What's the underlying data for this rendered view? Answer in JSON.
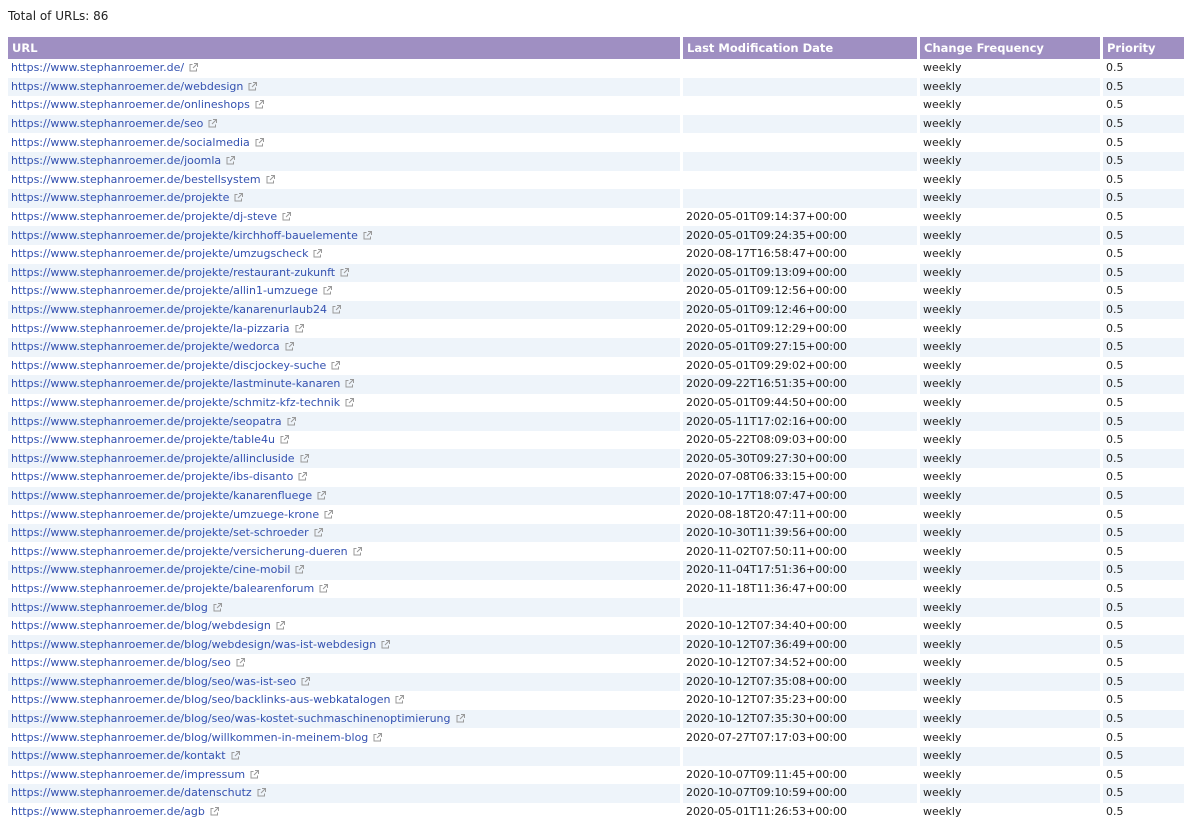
{
  "summary": {
    "total_label": "Total of URLs: 86"
  },
  "table": {
    "headers": {
      "url": "URL",
      "lastmod": "Last Modification Date",
      "changefreq": "Change Frequency",
      "priority": "Priority"
    },
    "rows": [
      {
        "url": "https://www.stephanroemer.de/",
        "lastmod": "",
        "changefreq": "weekly",
        "priority": "0.5"
      },
      {
        "url": "https://www.stephanroemer.de/webdesign",
        "lastmod": "",
        "changefreq": "weekly",
        "priority": "0.5"
      },
      {
        "url": "https://www.stephanroemer.de/onlineshops",
        "lastmod": "",
        "changefreq": "weekly",
        "priority": "0.5"
      },
      {
        "url": "https://www.stephanroemer.de/seo",
        "lastmod": "",
        "changefreq": "weekly",
        "priority": "0.5"
      },
      {
        "url": "https://www.stephanroemer.de/socialmedia",
        "lastmod": "",
        "changefreq": "weekly",
        "priority": "0.5"
      },
      {
        "url": "https://www.stephanroemer.de/joomla",
        "lastmod": "",
        "changefreq": "weekly",
        "priority": "0.5"
      },
      {
        "url": "https://www.stephanroemer.de/bestellsystem",
        "lastmod": "",
        "changefreq": "weekly",
        "priority": "0.5"
      },
      {
        "url": "https://www.stephanroemer.de/projekte",
        "lastmod": "",
        "changefreq": "weekly",
        "priority": "0.5"
      },
      {
        "url": "https://www.stephanroemer.de/projekte/dj-steve",
        "lastmod": "2020-05-01T09:14:37+00:00",
        "changefreq": "weekly",
        "priority": "0.5"
      },
      {
        "url": "https://www.stephanroemer.de/projekte/kirchhoff-bauelemente",
        "lastmod": "2020-05-01T09:24:35+00:00",
        "changefreq": "weekly",
        "priority": "0.5"
      },
      {
        "url": "https://www.stephanroemer.de/projekte/umzugscheck",
        "lastmod": "2020-08-17T16:58:47+00:00",
        "changefreq": "weekly",
        "priority": "0.5"
      },
      {
        "url": "https://www.stephanroemer.de/projekte/restaurant-zukunft",
        "lastmod": "2020-05-01T09:13:09+00:00",
        "changefreq": "weekly",
        "priority": "0.5"
      },
      {
        "url": "https://www.stephanroemer.de/projekte/allin1-umzuege",
        "lastmod": "2020-05-01T09:12:56+00:00",
        "changefreq": "weekly",
        "priority": "0.5"
      },
      {
        "url": "https://www.stephanroemer.de/projekte/kanarenurlaub24",
        "lastmod": "2020-05-01T09:12:46+00:00",
        "changefreq": "weekly",
        "priority": "0.5"
      },
      {
        "url": "https://www.stephanroemer.de/projekte/la-pizzaria",
        "lastmod": "2020-05-01T09:12:29+00:00",
        "changefreq": "weekly",
        "priority": "0.5"
      },
      {
        "url": "https://www.stephanroemer.de/projekte/wedorca",
        "lastmod": "2020-05-01T09:27:15+00:00",
        "changefreq": "weekly",
        "priority": "0.5"
      },
      {
        "url": "https://www.stephanroemer.de/projekte/discjockey-suche",
        "lastmod": "2020-05-01T09:29:02+00:00",
        "changefreq": "weekly",
        "priority": "0.5"
      },
      {
        "url": "https://www.stephanroemer.de/projekte/lastminute-kanaren",
        "lastmod": "2020-09-22T16:51:35+00:00",
        "changefreq": "weekly",
        "priority": "0.5"
      },
      {
        "url": "https://www.stephanroemer.de/projekte/schmitz-kfz-technik",
        "lastmod": "2020-05-01T09:44:50+00:00",
        "changefreq": "weekly",
        "priority": "0.5"
      },
      {
        "url": "https://www.stephanroemer.de/projekte/seopatra",
        "lastmod": "2020-05-11T17:02:16+00:00",
        "changefreq": "weekly",
        "priority": "0.5"
      },
      {
        "url": "https://www.stephanroemer.de/projekte/table4u",
        "lastmod": "2020-05-22T08:09:03+00:00",
        "changefreq": "weekly",
        "priority": "0.5"
      },
      {
        "url": "https://www.stephanroemer.de/projekte/allincluside",
        "lastmod": "2020-05-30T09:27:30+00:00",
        "changefreq": "weekly",
        "priority": "0.5"
      },
      {
        "url": "https://www.stephanroemer.de/projekte/ibs-disanto",
        "lastmod": "2020-07-08T06:33:15+00:00",
        "changefreq": "weekly",
        "priority": "0.5"
      },
      {
        "url": "https://www.stephanroemer.de/projekte/kanarenfluege",
        "lastmod": "2020-10-17T18:07:47+00:00",
        "changefreq": "weekly",
        "priority": "0.5"
      },
      {
        "url": "https://www.stephanroemer.de/projekte/umzuege-krone",
        "lastmod": "2020-08-18T20:47:11+00:00",
        "changefreq": "weekly",
        "priority": "0.5"
      },
      {
        "url": "https://www.stephanroemer.de/projekte/set-schroeder",
        "lastmod": "2020-10-30T11:39:56+00:00",
        "changefreq": "weekly",
        "priority": "0.5"
      },
      {
        "url": "https://www.stephanroemer.de/projekte/versicherung-dueren",
        "lastmod": "2020-11-02T07:50:11+00:00",
        "changefreq": "weekly",
        "priority": "0.5"
      },
      {
        "url": "https://www.stephanroemer.de/projekte/cine-mobil",
        "lastmod": "2020-11-04T17:51:36+00:00",
        "changefreq": "weekly",
        "priority": "0.5"
      },
      {
        "url": "https://www.stephanroemer.de/projekte/balearenforum",
        "lastmod": "2020-11-18T11:36:47+00:00",
        "changefreq": "weekly",
        "priority": "0.5"
      },
      {
        "url": "https://www.stephanroemer.de/blog",
        "lastmod": "",
        "changefreq": "weekly",
        "priority": "0.5"
      },
      {
        "url": "https://www.stephanroemer.de/blog/webdesign",
        "lastmod": "2020-10-12T07:34:40+00:00",
        "changefreq": "weekly",
        "priority": "0.5"
      },
      {
        "url": "https://www.stephanroemer.de/blog/webdesign/was-ist-webdesign",
        "lastmod": "2020-10-12T07:36:49+00:00",
        "changefreq": "weekly",
        "priority": "0.5"
      },
      {
        "url": "https://www.stephanroemer.de/blog/seo",
        "lastmod": "2020-10-12T07:34:52+00:00",
        "changefreq": "weekly",
        "priority": "0.5"
      },
      {
        "url": "https://www.stephanroemer.de/blog/seo/was-ist-seo",
        "lastmod": "2020-10-12T07:35:08+00:00",
        "changefreq": "weekly",
        "priority": "0.5"
      },
      {
        "url": "https://www.stephanroemer.de/blog/seo/backlinks-aus-webkatalogen",
        "lastmod": "2020-10-12T07:35:23+00:00",
        "changefreq": "weekly",
        "priority": "0.5"
      },
      {
        "url": "https://www.stephanroemer.de/blog/seo/was-kostet-suchmaschinenoptimierung",
        "lastmod": "2020-10-12T07:35:30+00:00",
        "changefreq": "weekly",
        "priority": "0.5"
      },
      {
        "url": "https://www.stephanroemer.de/blog/willkommen-in-meinem-blog",
        "lastmod": "2020-07-27T07:17:03+00:00",
        "changefreq": "weekly",
        "priority": "0.5"
      },
      {
        "url": "https://www.stephanroemer.de/kontakt",
        "lastmod": "",
        "changefreq": "weekly",
        "priority": "0.5"
      },
      {
        "url": "https://www.stephanroemer.de/impressum",
        "lastmod": "2020-10-07T09:11:45+00:00",
        "changefreq": "weekly",
        "priority": "0.5"
      },
      {
        "url": "https://www.stephanroemer.de/datenschutz",
        "lastmod": "2020-10-07T09:10:59+00:00",
        "changefreq": "weekly",
        "priority": "0.5"
      },
      {
        "url": "https://www.stephanroemer.de/agb",
        "lastmod": "2020-05-01T11:26:53+00:00",
        "changefreq": "weekly",
        "priority": "0.5"
      }
    ]
  },
  "icons": {
    "external": "external-link-icon"
  },
  "colors": {
    "header_bg": "#9f8fc2",
    "header_text": "#ffffff",
    "row_stripe": "#eef4fa",
    "link": "#3351b0"
  }
}
